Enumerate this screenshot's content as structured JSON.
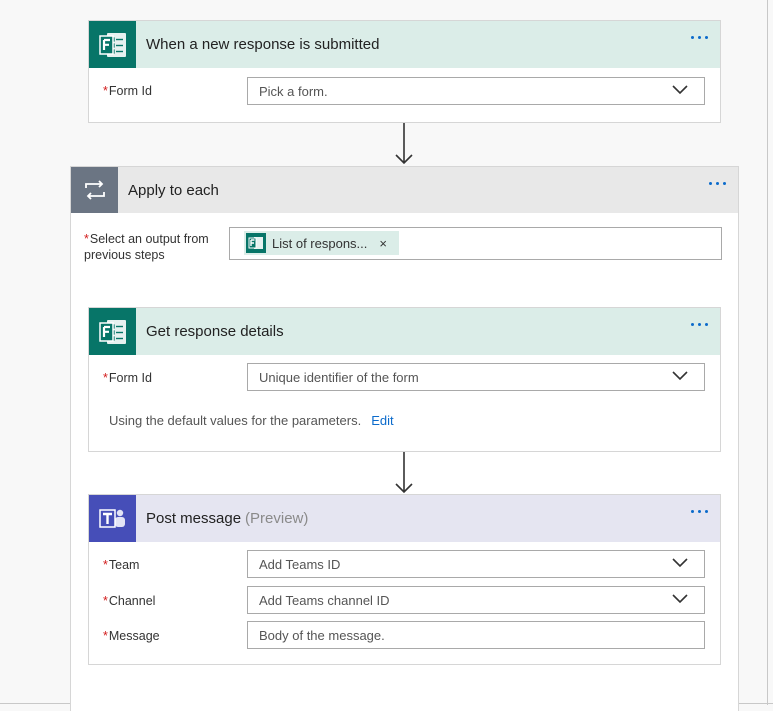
{
  "trigger": {
    "title": "When a new response is submitted",
    "icon": "ms-forms-icon",
    "form_id": {
      "label": "Form Id",
      "value": "Pick a form."
    }
  },
  "apply_each": {
    "title": "Apply to each",
    "icon": "loop-icon",
    "select_label_1": "Select an output from",
    "select_label_2": "previous steps",
    "token": {
      "text": "List of respons...",
      "remove": "×"
    }
  },
  "get_details": {
    "title": "Get response details",
    "icon": "ms-forms-icon",
    "form_id": {
      "label": "Form Id",
      "value": "Unique identifier of the form"
    },
    "note": "Using the default values for the parameters.",
    "edit_link": "Edit"
  },
  "post_message": {
    "title": "Post message",
    "title_suffix": "(Preview)",
    "icon": "ms-teams-icon",
    "team": {
      "label": "Team",
      "value": "Add Teams ID"
    },
    "channel": {
      "label": "Channel",
      "value": "Add Teams channel ID"
    },
    "message": {
      "label": "Message",
      "value": "Body of the message."
    }
  },
  "required_marker": "*",
  "colors": {
    "forms_tile": "#077568",
    "forms_header": "#dbede8",
    "teams_tile": "#464eb8",
    "teams_header": "#e5e5f1",
    "loop_tile": "#6b7583",
    "accent": "#0c6bcb",
    "required": "#d21b1b"
  }
}
